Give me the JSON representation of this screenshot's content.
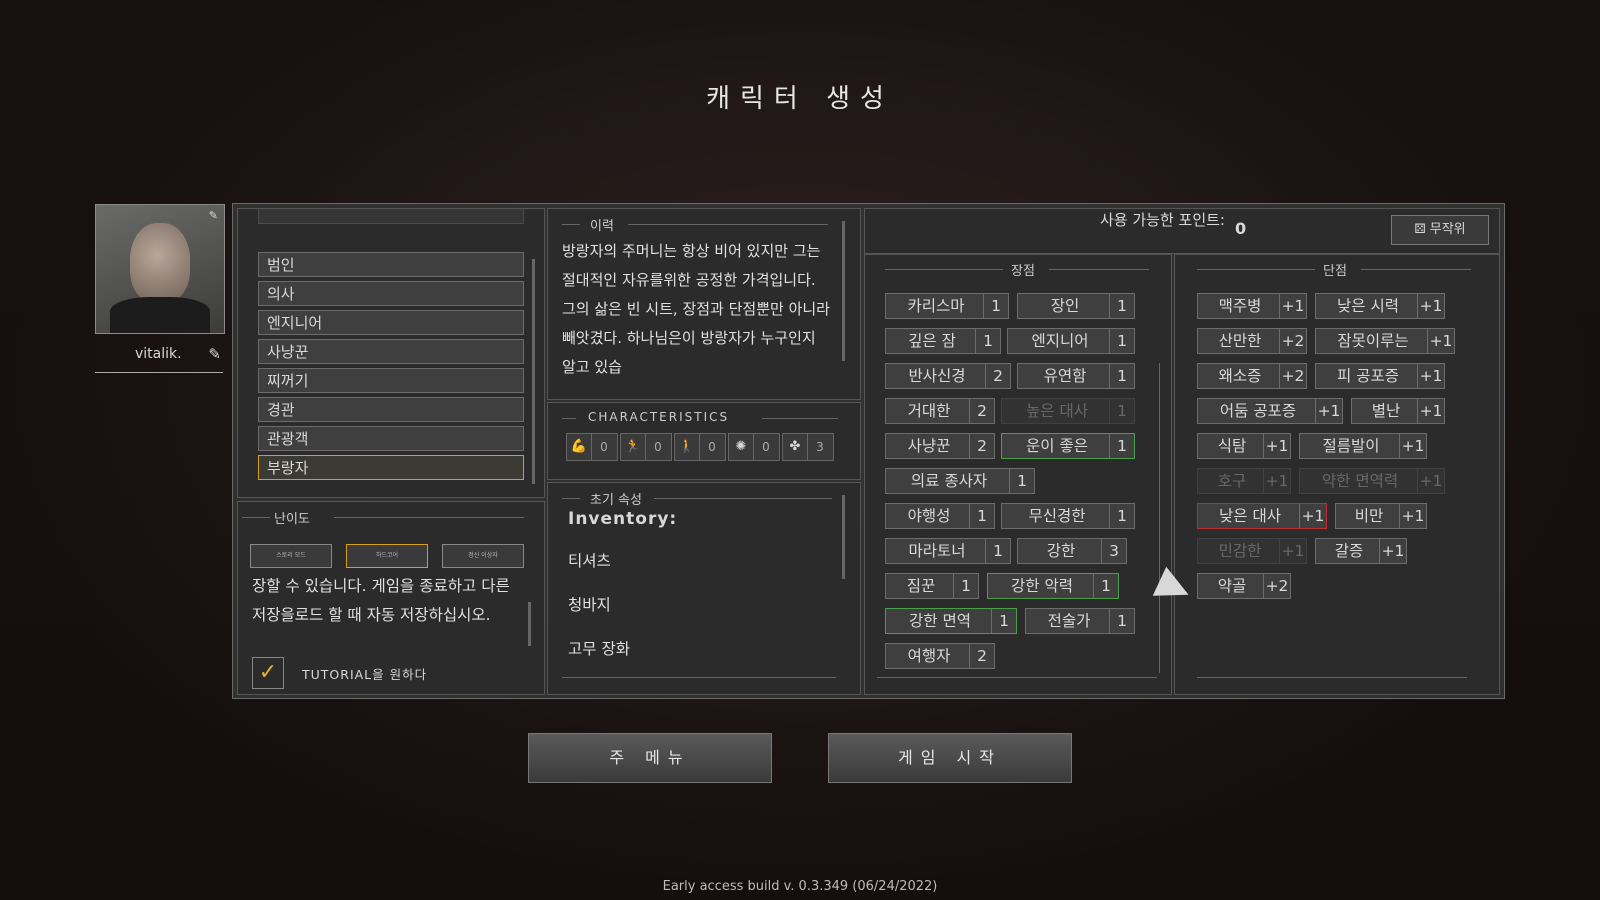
{
  "title": "캐릭터 생성",
  "portrait": {
    "name": "vitalik."
  },
  "professions": [
    "범인",
    "의사",
    "엔지니어",
    "사냥꾼",
    "찌꺼기",
    "경관",
    "관광객",
    "부랑자"
  ],
  "selected_profession": "부랑자",
  "difficulty": {
    "label": "난이도",
    "buttons": [
      "스토리 모드",
      "하드코어",
      "정신 이상자"
    ],
    "text": "장할 수 있습니다. 게임을 종료하고 다른 저장을로드 할 때 자동 저장하십시오.",
    "tutorial_label": "TUTORIAL을 원하다",
    "tutorial_checked": true
  },
  "history": {
    "label": "이력",
    "text": "방랑자의 주머니는 항상 비어 있지만 그는 절대적인 자유를위한 공정한 가격입니다. 그의 삶은 빈 시트, 장점과 단점뿐만 아니라 빼앗겼다. 하나님은이 방랑자가 누구인지 알고 있습"
  },
  "characteristics": {
    "label": "CHARACTERISTICS",
    "values": [
      0,
      0,
      0,
      0,
      3
    ]
  },
  "initial": {
    "label": "초기 속성",
    "inventory_label": "Inventory:",
    "items": [
      "티셔츠",
      "청바지",
      "고무 장화"
    ]
  },
  "points": {
    "label": "사용 가능한 포인트:",
    "value": "0",
    "random": "무작위"
  },
  "pros": {
    "label": "장점",
    "items": [
      {
        "name": "카리스마",
        "cost": "1"
      },
      {
        "name": "장인",
        "cost": "1"
      },
      {
        "name": "깊은 잠",
        "cost": "1"
      },
      {
        "name": "엔지니어",
        "cost": "1"
      },
      {
        "name": "반사신경",
        "cost": "2"
      },
      {
        "name": "유연함",
        "cost": "1"
      },
      {
        "name": "거대한",
        "cost": "2"
      },
      {
        "name": "높은 대사",
        "cost": "1"
      },
      {
        "name": "사냥꾼",
        "cost": "2"
      },
      {
        "name": "운이 좋은",
        "cost": "1"
      },
      {
        "name": "의료 종사자",
        "cost": "1"
      },
      {
        "name": "야행성",
        "cost": "1"
      },
      {
        "name": "무신경한",
        "cost": "1"
      },
      {
        "name": "마라토너",
        "cost": "1"
      },
      {
        "name": "강한",
        "cost": "3"
      },
      {
        "name": "짐꾼",
        "cost": "1"
      },
      {
        "name": "강한 악력",
        "cost": "1"
      },
      {
        "name": "강한 면역",
        "cost": "1"
      },
      {
        "name": "전술가",
        "cost": "1"
      },
      {
        "name": "여행자",
        "cost": "2"
      }
    ]
  },
  "cons": {
    "label": "단점",
    "items": [
      {
        "name": "맥주병",
        "cost": "+1"
      },
      {
        "name": "낮은 시력",
        "cost": "+1"
      },
      {
        "name": "산만한",
        "cost": "+2"
      },
      {
        "name": "잠못이루는",
        "cost": "+1"
      },
      {
        "name": "왜소증",
        "cost": "+2"
      },
      {
        "name": "피 공포증",
        "cost": "+1"
      },
      {
        "name": "어둠 공포증",
        "cost": "+1"
      },
      {
        "name": "별난",
        "cost": "+1"
      },
      {
        "name": "식탐",
        "cost": "+1"
      },
      {
        "name": "절름발이",
        "cost": "+1"
      },
      {
        "name": "호구",
        "cost": "+1"
      },
      {
        "name": "약한 면역력",
        "cost": "+1"
      },
      {
        "name": "낮은 대사",
        "cost": "+1"
      },
      {
        "name": "비만",
        "cost": "+1"
      },
      {
        "name": "민감한",
        "cost": "+1"
      },
      {
        "name": "갈증",
        "cost": "+1"
      },
      {
        "name": "약골",
        "cost": "+2"
      }
    ]
  },
  "buttons": {
    "main_menu": "주 메뉴",
    "start": "게임 시작"
  },
  "build": "Early access build v. 0.3.349 (06/24/2022)",
  "colors": {
    "selected": "#d4a020",
    "positive": "#4aa04a",
    "negative": "#c03030"
  }
}
